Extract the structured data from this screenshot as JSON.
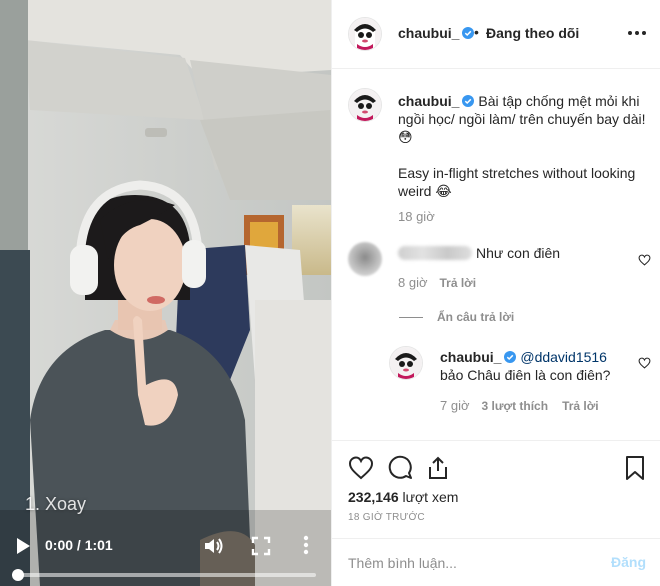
{
  "video": {
    "overlay_caption": "1. Xoay",
    "time": "0:00 / 1:01",
    "progress_fraction": 0.0,
    "icons": [
      "play-icon",
      "volume-icon",
      "fullscreen-icon",
      "more-vertical-icon"
    ]
  },
  "header": {
    "username": "chaubui_",
    "separator": "•",
    "follow_status": "Đang theo dõi",
    "icons": [
      "verified-badge-icon",
      "more-horizontal-icon"
    ]
  },
  "caption": {
    "username": "chaubui_",
    "line1": "Bài tập chống mệt mỏi khi",
    "line2": "ngồi học/ ngồi làm/ trên chuyến bay dài!",
    "line3": "😳",
    "line4": "Easy in-flight stretches without looking",
    "line5": "weird 😂",
    "time": "18 giờ"
  },
  "comment1": {
    "text": "Như con điên",
    "time": "8 giờ",
    "reply": "Trả lời"
  },
  "hide_replies": "Ẩn câu trả lời",
  "reply1": {
    "username": "chaubui_",
    "mention": "@ddavid1516",
    "text": "bảo Châu điên là con điên?",
    "time": "7 giờ",
    "likes": "3 lượt thích",
    "reply": "Trả lời"
  },
  "actions": {
    "icons": [
      "heart-icon",
      "comment-icon",
      "share-icon",
      "bookmark-icon"
    ],
    "views_count": "232,146",
    "views_label": "lượt xem",
    "posted_ago": "18 GIỜ TRƯỚC"
  },
  "add_comment": {
    "placeholder": "Thêm bình luận...",
    "post_label": "Đăng"
  },
  "colors": {
    "verified": "#3897f0",
    "text": "#262626",
    "muted": "#8e8e8e",
    "post_disabled": "#b2dffc",
    "mention": "#003569"
  }
}
